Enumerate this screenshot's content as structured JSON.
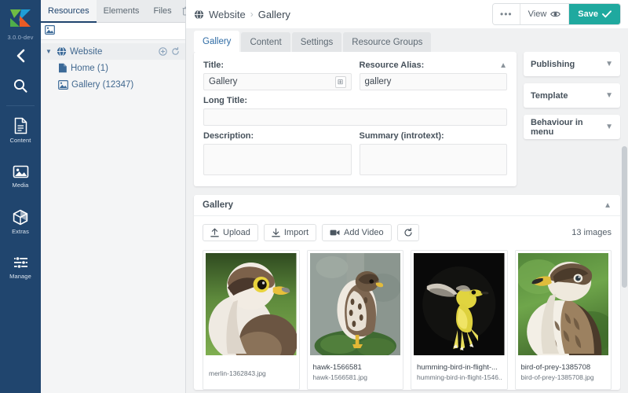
{
  "rail": {
    "version": "3.0.0-dev",
    "collapse_icon": "chevron-left-icon",
    "search_icon": "search-icon",
    "items": [
      {
        "label": "Content",
        "icon": "document-icon"
      },
      {
        "label": "Media",
        "icon": "image-icon"
      },
      {
        "label": "Extras",
        "icon": "cube-icon"
      },
      {
        "label": "Manage",
        "icon": "sliders-icon"
      }
    ]
  },
  "tree": {
    "tabs": [
      {
        "label": "Resources"
      },
      {
        "label": "Elements"
      },
      {
        "label": "Files"
      }
    ],
    "trash_icon": "trash-icon",
    "toolbar_icon": "image-icon",
    "add_icon": "plus-circle-icon",
    "refresh_icon": "refresh-icon",
    "nodes": [
      {
        "label": "Website",
        "icon": "globe-icon",
        "level": 0,
        "expanded": true
      },
      {
        "label": "Home (1)",
        "icon": "page-icon",
        "level": 1
      },
      {
        "label": "Gallery (12347)",
        "icon": "image-icon",
        "level": 1
      }
    ]
  },
  "topbar": {
    "breadcrumb_root": "Website",
    "breadcrumb_sep": "›",
    "breadcrumb_current": "Gallery",
    "globe_icon": "globe-icon",
    "more_label": "•••",
    "view_label": "View",
    "view_icon": "eye-icon",
    "save_label": "Save",
    "save_icon": "check-icon",
    "save_color": "#1fa99f"
  },
  "tabs": [
    {
      "label": "Gallery",
      "active": true
    },
    {
      "label": "Content",
      "active": false
    },
    {
      "label": "Settings",
      "active": false
    },
    {
      "label": "Resource Groups",
      "active": false
    }
  ],
  "form": {
    "title_label": "Title:",
    "title_value": "Gallery",
    "title_btn_icon": "insert-icon",
    "alias_label": "Resource Alias:",
    "alias_value": "gallery",
    "alias_chev_icon": "chevron-up-icon",
    "longtitle_label": "Long Title:",
    "longtitle_value": "",
    "description_label": "Description:",
    "description_value": "",
    "summary_label": "Summary (introtext):",
    "summary_value": ""
  },
  "sidepanels": [
    {
      "label": "Publishing",
      "chev": "chevron-down-icon"
    },
    {
      "label": "Template",
      "chev": "chevron-down-icon"
    },
    {
      "label": "Behaviour in menu",
      "chev": "chevron-down-icon"
    }
  ],
  "gallery": {
    "title": "Gallery",
    "collapse_icon": "chevron-up-icon",
    "buttons": [
      {
        "label": "Upload",
        "icon": "upload-icon"
      },
      {
        "label": "Import",
        "icon": "download-icon"
      },
      {
        "label": "Add Video",
        "icon": "video-icon"
      }
    ],
    "refresh_icon": "refresh-icon",
    "count_label": "13 images",
    "items": [
      {
        "name": "",
        "file": "merlin-1362843.jpg",
        "single": true,
        "img": "merlin"
      },
      {
        "name": "hawk-1566581",
        "file": "hawk-1566581.jpg",
        "single": false,
        "img": "hawk"
      },
      {
        "name": "humming-bird-in-flight-...",
        "file": "humming-bird-in-flight-1546...",
        "single": false,
        "img": "hummingbird"
      },
      {
        "name": "bird-of-prey-1385708",
        "file": "bird-of-prey-1385708.jpg",
        "single": false,
        "img": "prey"
      }
    ]
  }
}
